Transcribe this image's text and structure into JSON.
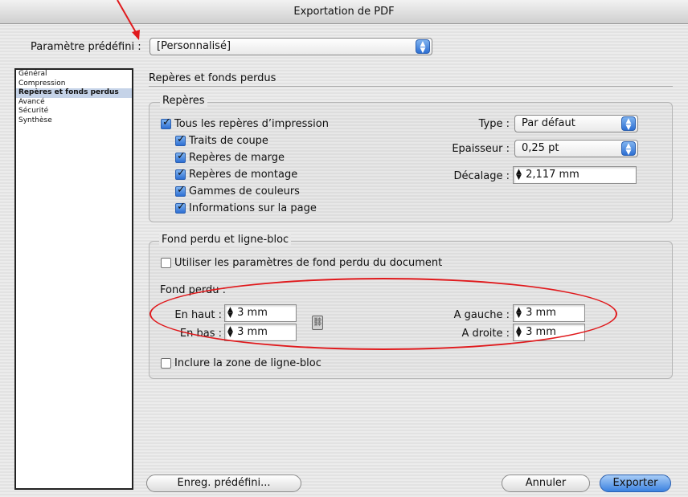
{
  "window": {
    "title": "Exportation de PDF"
  },
  "preset": {
    "label": "Paramètre prédéfini :",
    "value": "[Personnalisé]"
  },
  "sidebar": {
    "items": [
      {
        "label": "Général",
        "selected": false
      },
      {
        "label": "Compression",
        "selected": false
      },
      {
        "label": "Repères et fonds perdus",
        "selected": true
      },
      {
        "label": "Avancé",
        "selected": false
      },
      {
        "label": "Sécurité",
        "selected": false
      },
      {
        "label": "Synthèse",
        "selected": false
      }
    ]
  },
  "section": {
    "title": "Repères et fonds perdus"
  },
  "marks": {
    "title": "Repères",
    "all": {
      "label": "Tous les repères d’impression",
      "checked": true
    },
    "crop": {
      "label": "Traits de coupe",
      "checked": true
    },
    "bleed": {
      "label": "Repères de marge",
      "checked": true
    },
    "registration": {
      "label": "Repères de montage",
      "checked": true
    },
    "color_bars": {
      "label": "Gammes de couleurs",
      "checked": true
    },
    "page_info": {
      "label": "Informations sur la page",
      "checked": true
    },
    "type": {
      "label": "Type :",
      "value": "Par défaut"
    },
    "weight": {
      "label": "Epaisseur :",
      "value": "0,25 pt"
    },
    "offset": {
      "label": "Décalage :",
      "value": "2,117 mm"
    }
  },
  "bleed_slug": {
    "title": "Fond perdu et ligne-bloc",
    "use_doc": {
      "label": "Utiliser les paramètres de fond perdu du document",
      "checked": false
    },
    "bleed_title": "Fond perdu :",
    "top": {
      "label": "En haut :",
      "value": "3 mm"
    },
    "bottom": {
      "label": "En bas :",
      "value": "3 mm"
    },
    "left": {
      "label": "A gauche :",
      "value": "3 mm"
    },
    "right": {
      "label": "A droite :",
      "value": "3 mm"
    },
    "include_slug": {
      "label": "Inclure la zone de ligne-bloc",
      "checked": false
    }
  },
  "buttons": {
    "save_preset": "Enreg. prédéfini...",
    "cancel": "Annuler",
    "export": "Exporter"
  },
  "colors": {
    "annotation": "#e0191c",
    "accent": "#2d6fd3"
  }
}
